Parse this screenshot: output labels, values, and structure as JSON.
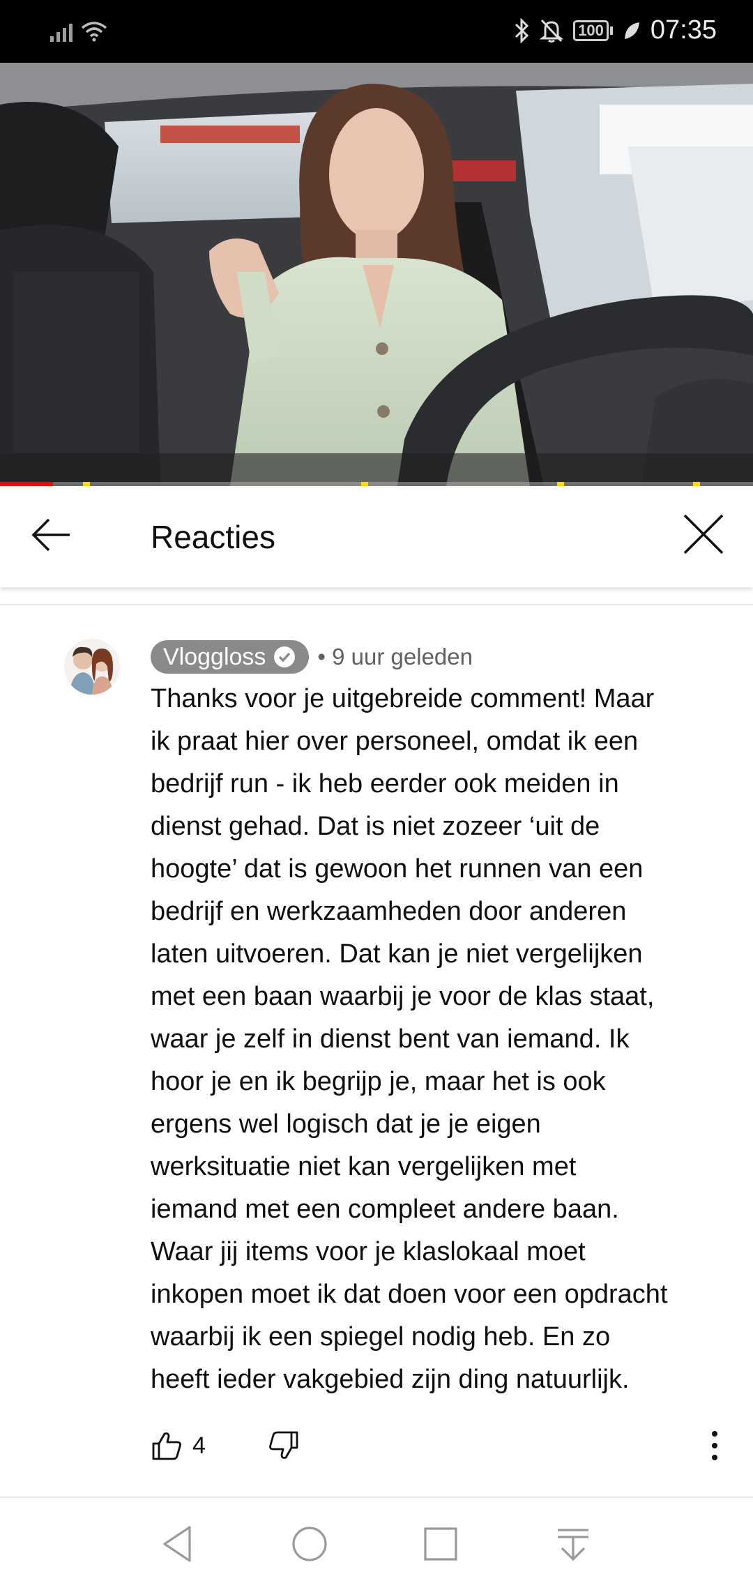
{
  "status_bar": {
    "time": "07:35",
    "battery": "100",
    "icons": [
      "signal-icon",
      "wifi-icon",
      "bluetooth-icon",
      "mute-icon",
      "battery-icon",
      "leaf-icon"
    ]
  },
  "video": {
    "progress_fraction": 0.07,
    "chapter_marks_fraction": [
      0.11,
      0.48,
      0.74,
      0.92
    ]
  },
  "header": {
    "title": "Reacties",
    "back_icon": "arrow-left-icon",
    "close_icon": "close-icon"
  },
  "comment": {
    "author": "Vloggloss",
    "verified": true,
    "meta": "• 9 uur geleden",
    "lines": [
      "Thanks voor je uitgebreide comment! Maar",
      "ik praat hier over personeel, omdat ik een",
      "bedrijf run - ik heb eerder ook meiden in",
      "dienst gehad. Dat is niet zozeer ‘uit de",
      "hoogte’ dat is gewoon het runnen van een",
      "bedrijf en werkzaamheden door anderen",
      "laten uitvoeren. Dat kan je niet vergelijken",
      "met een baan waarbij je voor de klas staat,",
      "waar je zelf in dienst bent van iemand. Ik",
      "hoor je en ik begrijp je, maar het is ook",
      "ergens wel logisch dat je je eigen",
      "werksituatie niet kan vergelijken met",
      "iemand met een compleet andere baan.",
      "Waar jij items voor je klaslokaal moet",
      "inkopen moet ik dat doen voor een opdracht",
      "waarbij ik een spiegel nodig heb. En zo",
      "heeft ieder vakgebied zijn ding natuurlijk."
    ],
    "like_count": "4"
  },
  "nav_bar": {
    "icons": [
      "back-triangle-icon",
      "home-circle-icon",
      "recents-square-icon",
      "notification-pull-icon"
    ]
  }
}
